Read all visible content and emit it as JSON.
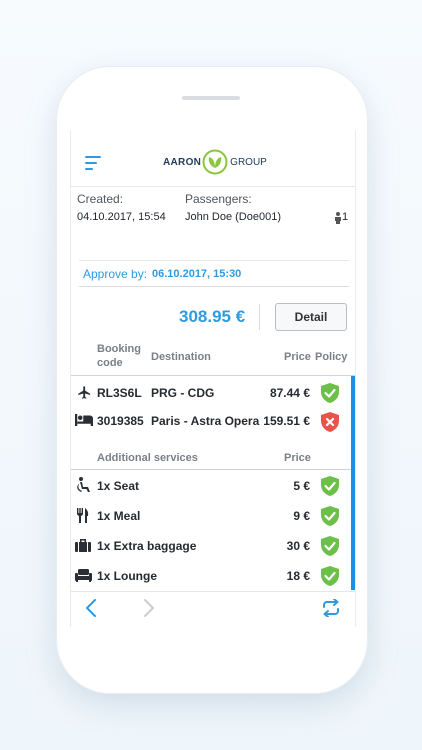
{
  "header": {
    "logo_left": "AARON",
    "logo_right": "GROUP"
  },
  "info": {
    "created_label": "Created:",
    "created_value": "04.10.2017, 15:54",
    "passengers_label": "Passengers:",
    "passengers_value": "John Doe (Doe001)",
    "passenger_count": "1"
  },
  "approve": {
    "label": "Approve by:",
    "date": "06.10.2017, 15:30"
  },
  "summary": {
    "total": "308.95 €",
    "detail_label": "Detail"
  },
  "table": {
    "headers": {
      "booking_code_line1": "Booking",
      "booking_code_line2": "code",
      "destination": "Destination",
      "price": "Price",
      "policy": "Policy"
    },
    "rows": [
      {
        "icon": "plane-icon",
        "code": "RL3S6L",
        "destination": "PRG - CDG",
        "price": "87.44 €",
        "policy": "ok"
      },
      {
        "icon": "bed-icon",
        "code": "3019385",
        "destination": "Paris - Astra Opera",
        "price": "159.51 €",
        "policy": "violation"
      }
    ]
  },
  "services": {
    "header": "Additional services",
    "price_header": "Price",
    "items": [
      {
        "icon": "seat-icon",
        "label": "1x Seat",
        "price": "5 €",
        "policy": "ok"
      },
      {
        "icon": "meal-icon",
        "label": "1x Meal",
        "price": "9 €",
        "policy": "ok"
      },
      {
        "icon": "baggage-icon",
        "label": "1x Extra baggage",
        "price": "30 €",
        "policy": "ok"
      },
      {
        "icon": "lounge-icon",
        "label": "1x Lounge",
        "price": "18 €",
        "policy": "ok"
      }
    ]
  },
  "colors": {
    "accent": "#2e9be0",
    "ok": "#6cc04a",
    "violation": "#e8544a"
  }
}
